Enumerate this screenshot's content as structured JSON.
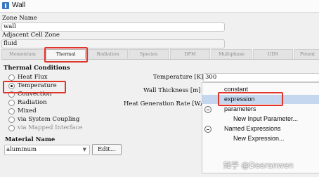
{
  "window": {
    "title": "Wall"
  },
  "zone_name": {
    "label": "Zone Name",
    "value": "wall"
  },
  "adjacent_cell_zone": {
    "label": "Adjacent Cell Zone",
    "value": "fluid"
  },
  "tabs": [
    "Momentum",
    "Thermal",
    "Radiation",
    "Species",
    "DPM",
    "Multiphase",
    "UDS",
    "Potent"
  ],
  "thermal_conditions": {
    "title": "Thermal Conditions",
    "options": [
      "Heat Flux",
      "Temperature",
      "Convection",
      "Radiation",
      "Mixed",
      "via System Coupling",
      "via Mapped Interface"
    ],
    "selected": "Temperature"
  },
  "temperature": {
    "label": "Temperature [K]",
    "value": "300"
  },
  "wall_thickness": {
    "label": "Wall Thickness [m]"
  },
  "heat_generation_rate": {
    "label": "Heat Generation Rate [W/"
  },
  "material": {
    "label": "Material Name",
    "value": "aluminum",
    "edit_label": "Edit..."
  },
  "dropdown_menu": {
    "items": [
      "constant",
      "expression",
      "parameters",
      "New Input Parameter...",
      "Named Expressions",
      "New Expression..."
    ],
    "selected": "expression"
  },
  "watermark": "知乎 @Dearanwen",
  "colors": {
    "highlight_box": "#e0352b",
    "menu_selected": "#c4d7ee",
    "accent": "#3b78c4"
  }
}
